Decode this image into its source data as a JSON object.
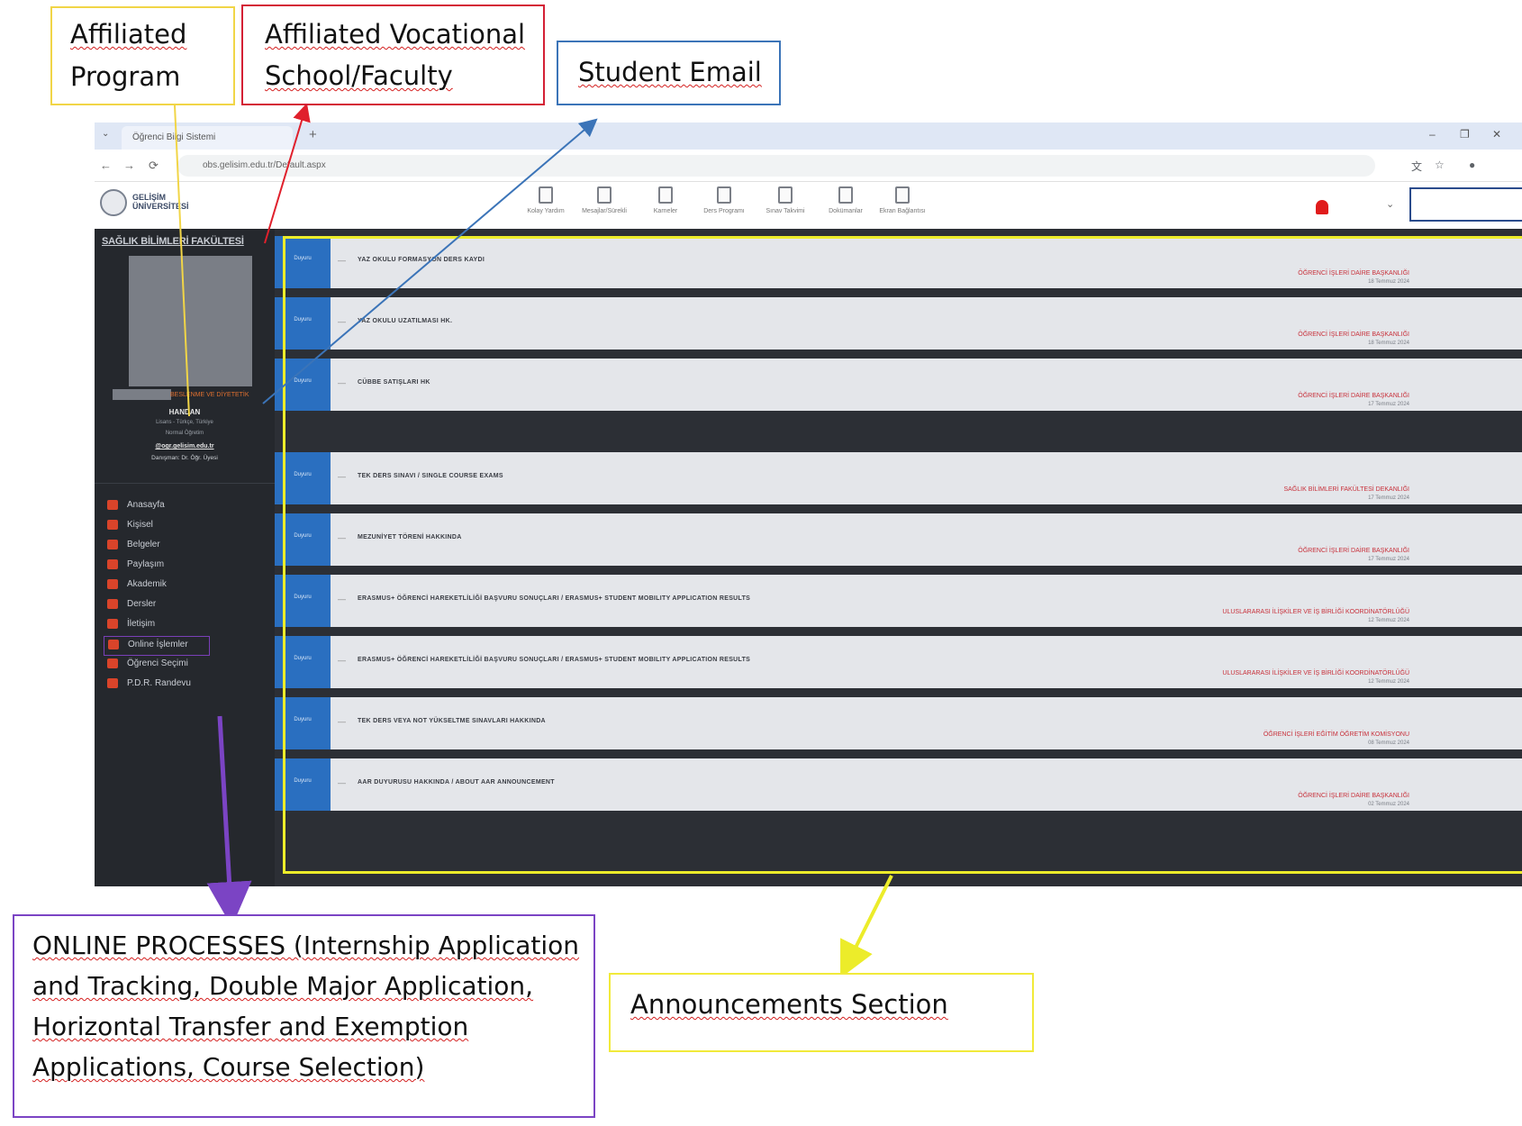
{
  "callouts": {
    "program_line1": "Affiliated",
    "program_line2": "Program",
    "faculty_line1": "Affiliated Vocational",
    "faculty_line2": "School/Faculty",
    "email": "Student Email",
    "online_processes": [
      "ONLINE PROCESSES (Internship Application",
      "and Tracking, Double Major Application,",
      "Horizontal Transfer and Exemption",
      "Applications, Course Selection)"
    ],
    "announcements": "Announcements Section"
  },
  "browser": {
    "tab_title": "Öğrenci Bilgi Sistemi",
    "url": "obs.gelisim.edu.tr/Default.aspx"
  },
  "app": {
    "logo_text": "GELİŞİM ÜNİVERSİTESİ",
    "toolbar": [
      {
        "label": "Kolay Yardım",
        "icon": "document-icon"
      },
      {
        "label": "Mesajlar/Sürekli",
        "icon": "clipboard-icon"
      },
      {
        "label": "Karneler",
        "icon": "report-icon"
      },
      {
        "label": "Ders Programı",
        "icon": "calendar-icon"
      },
      {
        "label": "Sınav Takvimi",
        "icon": "calendar-icon"
      },
      {
        "label": "Dokümanlar",
        "icon": "file-icon"
      },
      {
        "label": "Ekran Bağlantısı",
        "icon": "monitor-icon"
      }
    ]
  },
  "sidebar": {
    "faculty": "SAĞLIK BİLİMLERİ FAKÜLTESİ",
    "program": "BESLENME VE DİYETETİK",
    "student_name": "HANDAN",
    "student_meta": "Lisans - Türkçe, Türkiye",
    "student_meta2": "Normal Öğretim",
    "student_email": "@ogr.gelisim.edu.tr",
    "advisor": "Danışman: Dr. Öğr. Üyesi",
    "menu": [
      {
        "label": "Anasayfa"
      },
      {
        "label": "Kişisel"
      },
      {
        "label": "Belgeler"
      },
      {
        "label": "Paylaşım"
      },
      {
        "label": "Akademik"
      },
      {
        "label": "Dersler"
      },
      {
        "label": "İletişim"
      },
      {
        "label": "Online İşlemler"
      },
      {
        "label": "Öğrenci Seçimi"
      },
      {
        "label": "P.D.R. Randevu"
      }
    ]
  },
  "announcements": [
    {
      "badge": "Duyuru",
      "title": "YAZ OKULU FORMASYON DERS KAYDI",
      "source": "ÖĞRENCİ İŞLERİ DAİRE BAŞKANLIĞI",
      "date": "18 Temmuz 2024"
    },
    {
      "badge": "Duyuru",
      "title": "YAZ OKULU UZATILMASI HK.",
      "source": "ÖĞRENCİ İŞLERİ DAİRE BAŞKANLIĞI",
      "date": "18 Temmuz 2024"
    },
    {
      "badge": "Duyuru",
      "title": "CÜBBE SATIŞLARI HK",
      "source": "ÖĞRENCİ İŞLERİ DAİRE BAŞKANLIĞI",
      "date": "17 Temmuz 2024"
    },
    {
      "badge": "Duyuru",
      "title": "TEK DERS SINAVI / SINGLE COURSE EXAMS",
      "source": "SAĞLIK BİLİMLERİ FAKÜLTESİ DEKANLIĞI",
      "date": "17 Temmuz 2024"
    },
    {
      "badge": "Duyuru",
      "title": "MEZUNİYET TÖRENİ HAKKINDA",
      "source": "ÖĞRENCİ İŞLERİ DAİRE BAŞKANLIĞI",
      "date": "17 Temmuz 2024"
    },
    {
      "badge": "Duyuru",
      "title": "ERASMUS+ ÖĞRENCİ HAREKETLİLİĞİ BAŞVURU SONUÇLARI / ERASMUS+ STUDENT MOBILITY APPLICATION RESULTS",
      "source": "ULUSLARARASI İLİŞKİLER VE İŞ BİRLİĞİ KOORDİNATÖRLÜĞÜ",
      "date": "12 Temmuz 2024"
    },
    {
      "badge": "Duyuru",
      "title": "ERASMUS+ ÖĞRENCİ HAREKETLİLİĞİ BAŞVURU SONUÇLARI / ERASMUS+ STUDENT MOBILITY APPLICATION RESULTS",
      "source": "ULUSLARARASI İLİŞKİLER VE İŞ BİRLİĞİ KOORDİNATÖRLÜĞÜ",
      "date": "12 Temmuz 2024"
    },
    {
      "badge": "Duyuru",
      "title": "TEK DERS VEYA NOT YÜKSELTME SINAVLARI HAKKINDA",
      "source": "ÖĞRENCİ İŞLERİ EĞİTİM ÖĞRETİM KOMİSYONU",
      "date": "08 Temmuz 2024"
    },
    {
      "badge": "Duyuru",
      "title": "AAR DUYURUSU HAKKINDA / ABOUT AAR ANNOUNCEMENT",
      "source": "ÖĞRENCİ İŞLERİ DAİRE BAŞKANLIĞI",
      "date": "02 Temmuz 2024"
    }
  ],
  "colors": {
    "program_box": "#f1d547",
    "faculty_box": "#d42035",
    "email_box": "#3b74b8",
    "online_box": "#7b44c4",
    "announcement_box": "#f1ea3a",
    "badge_blue": "#2a6fc0",
    "sidebar_bg": "#25282d"
  }
}
